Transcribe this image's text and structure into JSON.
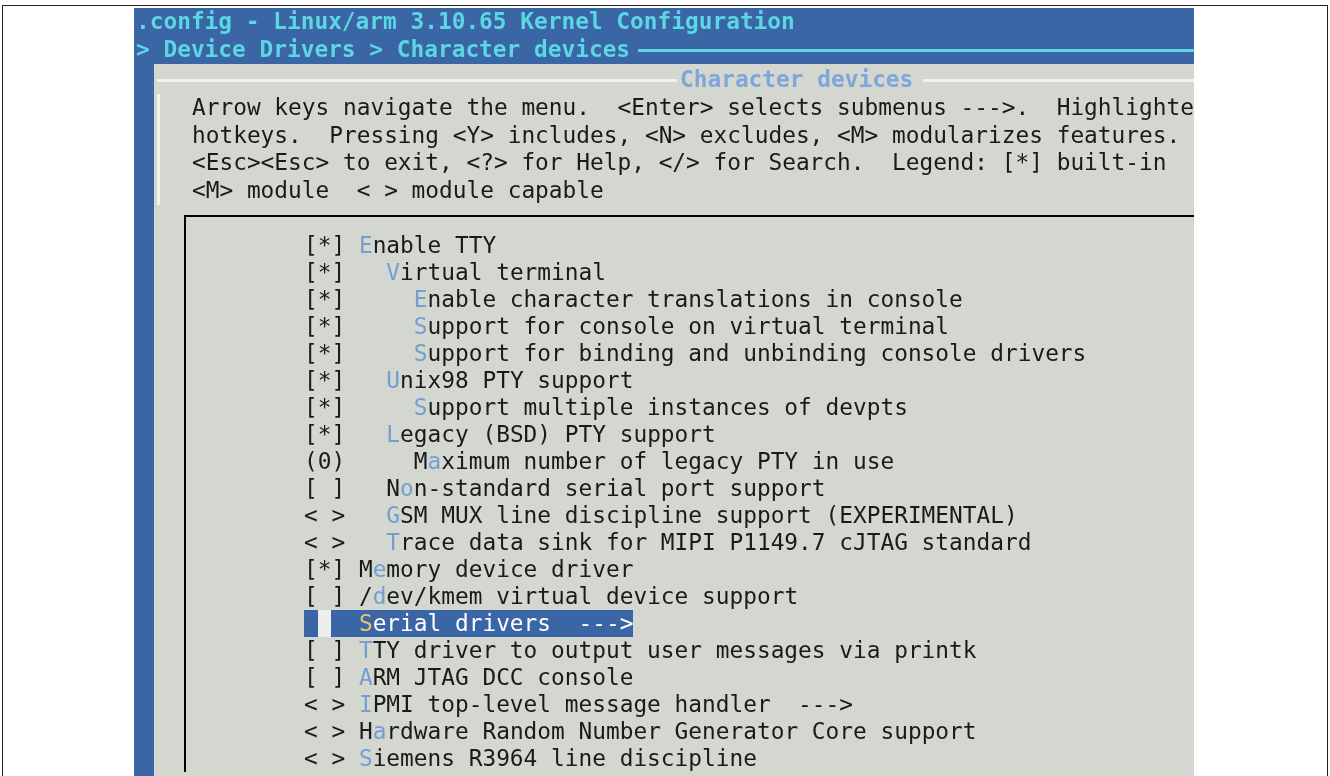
{
  "window": {
    "title": ".config - Linux/arm 3.10.65 Kernel Configuration"
  },
  "breadcrumb": "> Device Drivers > Character devices",
  "dialog": {
    "title": "Character devices",
    "help_lines": [
      "Arrow keys navigate the menu.  <Enter> selects submenus --->.  Highlighte",
      "hotkeys.  Pressing <Y> includes, <N> excludes, <M> modularizes features.",
      "<Esc><Esc> to exit, <?> for Help, </> for Search.  Legend: [*] built-in",
      "<M> module  < > module capable"
    ]
  },
  "items": [
    {
      "prompt": "[*]",
      "key": "E",
      "post": "nable TTY",
      "selected": false,
      "children": [
        {
          "prompt": "[*]",
          "key": "V",
          "post": "irtual terminal",
          "selected": false,
          "children": [
            {
              "prompt": "[*]",
              "key": "E",
              "post": "nable character translations in console",
              "selected": false
            },
            {
              "prompt": "[*]",
              "key": "S",
              "post": "upport for console on virtual terminal",
              "selected": false
            },
            {
              "prompt": "[*]",
              "key": "S",
              "post": "upport for binding and unbinding console drivers",
              "selected": false
            }
          ]
        },
        {
          "prompt": "[*]",
          "key": "U",
          "post": "nix98 PTY support",
          "selected": false,
          "children": [
            {
              "prompt": "[*]",
              "key": "S",
              "post": "upport multiple instances of devpts",
              "selected": false
            }
          ]
        },
        {
          "prompt": "[*]",
          "key": "L",
          "post": "egacy (BSD) PTY support",
          "selected": false,
          "children": [
            {
              "prompt": "(0)",
              "pre": "M",
              "key": "a",
              "post": "ximum number of legacy PTY in use",
              "selected": false
            }
          ]
        },
        {
          "prompt": "[ ]",
          "pre": "N",
          "key": "o",
          "post": "n-standard serial port support",
          "selected": false
        },
        {
          "prompt": "< >",
          "key": "G",
          "post": "SM MUX line discipline support (EXPERIMENTAL)",
          "selected": false
        },
        {
          "prompt": "< >",
          "key": "T",
          "post": "race data sink for MIPI P1149.7 cJTAG standard",
          "selected": false
        }
      ]
    },
    {
      "prompt": "[*]",
      "pre": "M",
      "key": "e",
      "post": "mory device driver",
      "selected": false
    },
    {
      "prompt": "[ ]",
      "pre": "/",
      "key": "d",
      "post": "ev/kmem virtual device support",
      "selected": false
    },
    {
      "key": "S",
      "post": "erial drivers",
      "submenu": "--->",
      "selected": true
    },
    {
      "prompt": "[ ]",
      "key": "T",
      "post": "TY driver to output user messages via printk",
      "selected": false
    },
    {
      "prompt": "[ ]",
      "key": "A",
      "post": "RM JTAG DCC console",
      "selected": false
    },
    {
      "prompt": "< >",
      "key": "I",
      "post": "PMI top-level message handler",
      "submenu": "--->",
      "selected": false
    },
    {
      "prompt": "< >",
      "pre": "H",
      "key": "a",
      "post": "rdware Random Number Generator Core support",
      "selected": false
    },
    {
      "prompt": "< >",
      "key": "S",
      "post": "iemens R3964 line discipline",
      "selected": false
    }
  ]
}
